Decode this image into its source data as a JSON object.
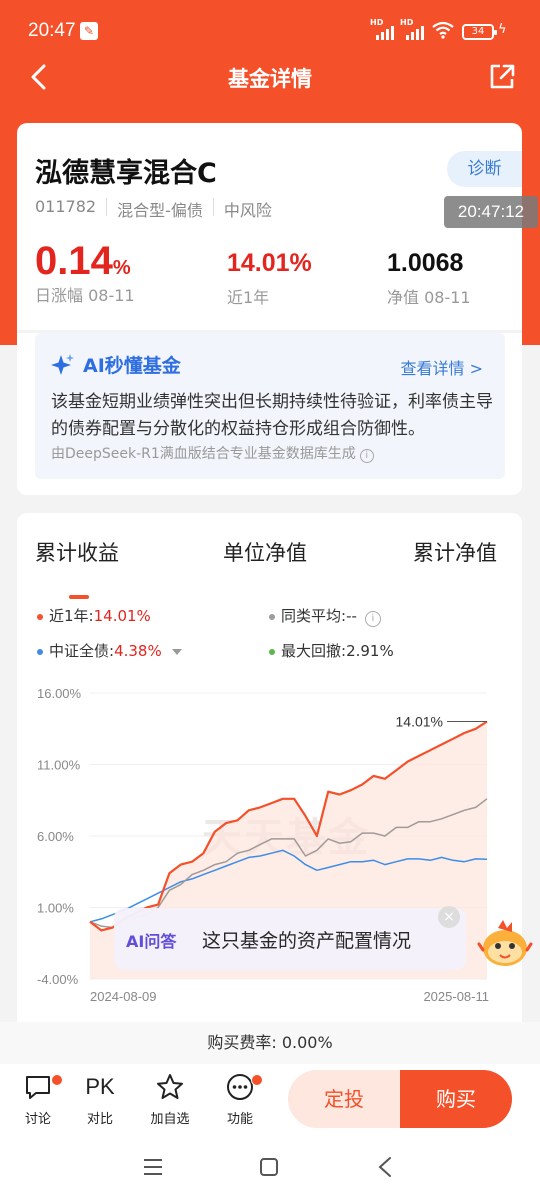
{
  "status": {
    "time": "20:47",
    "battery": "34"
  },
  "header": {
    "title": "基金详情"
  },
  "fund": {
    "name": "泓德慧享混合C",
    "code": "011782",
    "type": "混合型-偏债",
    "risk": "中风险",
    "diagnose_label": "诊断",
    "timestamp": "20:47:12",
    "daily_change": "0.14",
    "daily_change_unit": "%",
    "daily_label": "日涨幅 08-11",
    "year_return": "14.01%",
    "year_label": "近1年",
    "nav": "1.0068",
    "nav_label": "净值 08-11"
  },
  "ai_summary": {
    "title": "AI秒懂基金",
    "more": "查看详情 >",
    "text": "该基金短期业绩弹性突出但长期持续性待验证，利率债主导的债券配置与分散化的权益持仓形成组合防御性。",
    "source": "由DeepSeek-R1满血版结合专业基金数据库生成",
    "info_icon": "ⓘ"
  },
  "chart_tabs": [
    "累计收益",
    "单位净值",
    "累计净值"
  ],
  "legend": {
    "fund_label": "近1年:",
    "fund_value": "14.01%",
    "peer_label": "同类平均:",
    "peer_value": "--",
    "index_label": "中证全债:",
    "index_value": "4.38%",
    "drawdown_label": "最大回撤:",
    "drawdown_value": "2.91%"
  },
  "colors": {
    "fund": "#f4502a",
    "peer": "#a09a98",
    "index": "#3d8de8",
    "drawdown": "#5ab84a",
    "accent": "#f4502a"
  },
  "chart_data": {
    "type": "line",
    "y_ticks": [
      "16.00%",
      "11.00%",
      "6.00%",
      "1.00%",
      "-4.00%"
    ],
    "x_ticks": [
      "2024-08-09",
      "2025-08-11"
    ],
    "ylim": [
      -4,
      16
    ],
    "end_label": "14.01%",
    "watermark": "天天基金",
    "series": [
      {
        "name": "近1年",
        "color": "#f4502a",
        "values": [
          0.0,
          -0.6,
          -0.4,
          0.2,
          0.6,
          1.0,
          1.2,
          3.4,
          4.0,
          4.2,
          4.8,
          6.3,
          6.9,
          7.1,
          7.8,
          8.0,
          8.3,
          8.6,
          8.6,
          7.4,
          6.0,
          9.1,
          8.9,
          9.2,
          9.6,
          10.2,
          10.0,
          10.6,
          11.2,
          11.6,
          12.0,
          12.4,
          12.8,
          13.2,
          13.5,
          14.01
        ]
      },
      {
        "name": "同类平均",
        "color": "#a09a98",
        "values": [
          0.0,
          -0.3,
          -0.4,
          0.1,
          0.3,
          0.5,
          1.0,
          2.2,
          2.6,
          3.3,
          3.6,
          4.0,
          4.2,
          4.8,
          5.0,
          5.4,
          5.8,
          5.8,
          5.8,
          4.6,
          5.0,
          5.8,
          5.5,
          5.6,
          6.2,
          6.2,
          6.0,
          6.6,
          6.6,
          7.0,
          7.0,
          7.2,
          7.5,
          7.8,
          8.0,
          8.6
        ]
      },
      {
        "name": "中证全债",
        "color": "#3d8de8",
        "values": [
          0.0,
          0.2,
          0.5,
          0.8,
          1.2,
          1.6,
          2.0,
          2.4,
          2.8,
          3.0,
          3.3,
          3.6,
          3.9,
          4.2,
          4.5,
          4.6,
          4.8,
          5.0,
          4.6,
          4.0,
          3.6,
          3.8,
          4.0,
          4.2,
          4.2,
          4.3,
          4.0,
          4.2,
          4.4,
          4.4,
          4.3,
          4.5,
          4.3,
          4.2,
          4.4,
          4.38
        ]
      }
    ]
  },
  "ai_qa": {
    "tag": "AI问答",
    "question": "这只基金的资产配置情况"
  },
  "fee": {
    "label": "购买费率:",
    "value": "0.00%"
  },
  "bottom": {
    "items": [
      "讨论",
      "对比",
      "加自选",
      "功能"
    ],
    "pk": "PK",
    "invest": "定投",
    "buy": "购买"
  }
}
